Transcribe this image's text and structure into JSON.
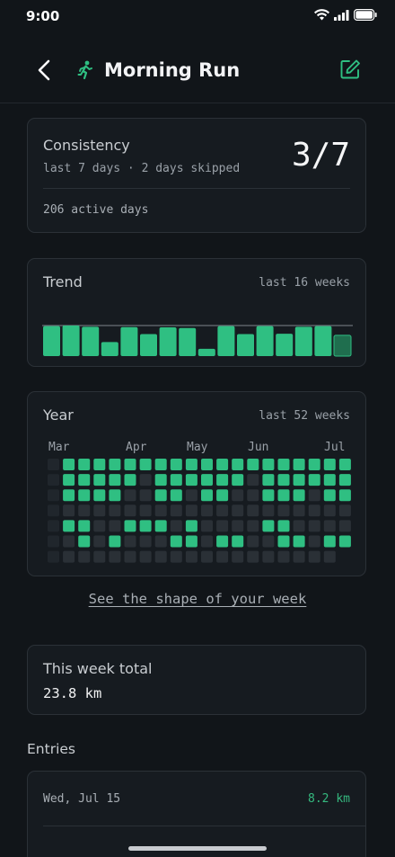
{
  "status_bar": {
    "time": "9:00"
  },
  "header": {
    "title": "Morning Run"
  },
  "consistency": {
    "label": "Consistency",
    "subtitle": "last 7 days · 2 days skipped",
    "ratio": "3/7",
    "active_days": "206 active days"
  },
  "trend": {
    "label": "Trend",
    "range": "last 16 weeks"
  },
  "year": {
    "label": "Year",
    "range": "last 52 weeks",
    "months": [
      "Mar",
      "Apr",
      "May",
      "Jun",
      "Jul"
    ]
  },
  "shape_link": "See the shape of your week",
  "week_total": {
    "label": "This week total",
    "value": "23.8 km"
  },
  "entries": {
    "heading": "Entries",
    "items": [
      {
        "date": "Wed, Jul 15",
        "distance": "8.2 km"
      }
    ]
  },
  "colors": {
    "accent": "#2fbf82",
    "empty_cell": "#2a3036",
    "background": "#111519"
  },
  "chart_data": [
    {
      "type": "bar",
      "name": "trend",
      "values": [
        0.98,
        1.0,
        0.96,
        0.46,
        0.95,
        0.72,
        0.94,
        0.92,
        0.24,
        0.98,
        0.72,
        0.98,
        0.73,
        0.96,
        0.98,
        0.68
      ],
      "current_week_index": 15,
      "reference_line": 1.0
    },
    {
      "type": "heatmap",
      "name": "year",
      "rows": [
        [
          0,
          1,
          1,
          1,
          1,
          1,
          1,
          1,
          1,
          1,
          1,
          1,
          1,
          1,
          1,
          1,
          1,
          1,
          1,
          1
        ],
        [
          0,
          1,
          1,
          1,
          1,
          1,
          0,
          1,
          1,
          1,
          1,
          1,
          1,
          0,
          1,
          1,
          1,
          1,
          1,
          1
        ],
        [
          0,
          1,
          1,
          1,
          1,
          0,
          0,
          1,
          1,
          0,
          1,
          1,
          0,
          0,
          1,
          1,
          1,
          0,
          1,
          1
        ],
        [
          0,
          0,
          0,
          0,
          0,
          0,
          0,
          0,
          0,
          0,
          0,
          0,
          0,
          0,
          0,
          0,
          0,
          0,
          0,
          0
        ],
        [
          0,
          1,
          1,
          0,
          0,
          1,
          1,
          1,
          0,
          1,
          0,
          0,
          0,
          0,
          1,
          1,
          0,
          0,
          0,
          0
        ],
        [
          0,
          0,
          1,
          0,
          1,
          0,
          0,
          0,
          1,
          1,
          0,
          1,
          1,
          0,
          0,
          1,
          1,
          0,
          1,
          1
        ],
        [
          0,
          0,
          0,
          0,
          0,
          0,
          0,
          0,
          0,
          0,
          0,
          0,
          0,
          0,
          0,
          0,
          0,
          0,
          0,
          0
        ]
      ],
      "partial_last_row_cols": 19
    }
  ]
}
